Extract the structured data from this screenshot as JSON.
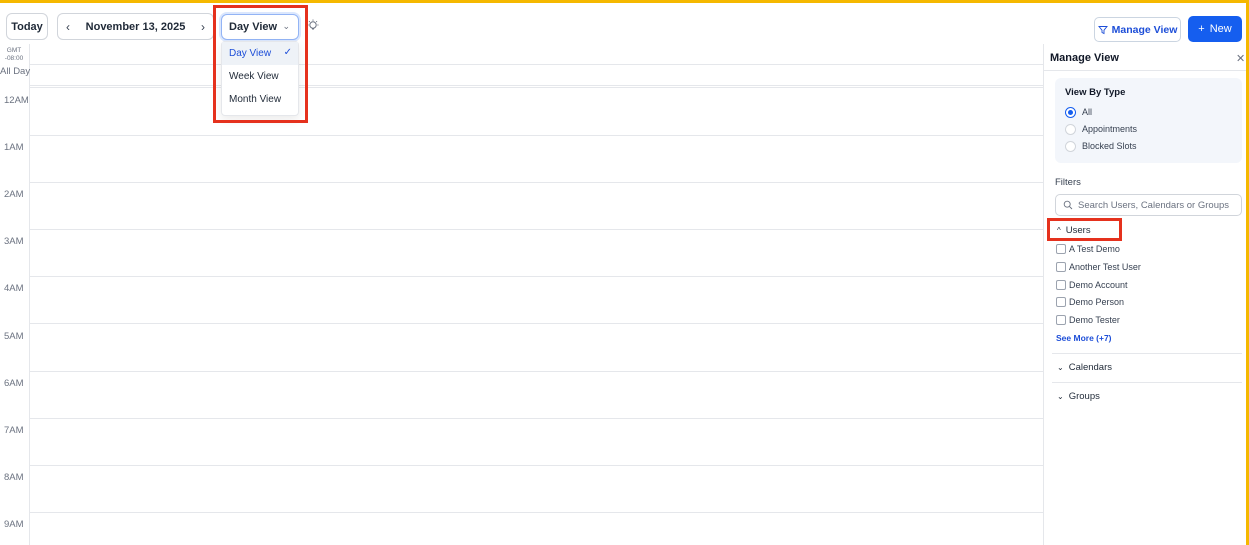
{
  "toolbar": {
    "today_label": "Today",
    "prev_icon": "chevron-left-icon",
    "next_icon": "chevron-right-icon",
    "date_label": "November 13, 2025",
    "view_selected": "Day View",
    "manage_view_label": "Manage View",
    "new_label": "New"
  },
  "view_dropdown": {
    "options": [
      {
        "label": "Day View",
        "selected": true
      },
      {
        "label": "Week View",
        "selected": false
      },
      {
        "label": "Month View",
        "selected": false
      }
    ]
  },
  "calendar": {
    "timezone": "GMT -08:00",
    "timezone_line1": "GMT",
    "timezone_line2": "-08:00",
    "all_day_label": "All Day",
    "hours": [
      "12AM",
      "1AM",
      "2AM",
      "3AM",
      "4AM",
      "5AM",
      "6AM",
      "7AM",
      "8AM",
      "9AM"
    ]
  },
  "manage_panel": {
    "title": "Manage View",
    "close_icon": "close-icon",
    "view_by_type": {
      "title": "View By Type",
      "options": [
        {
          "label": "All",
          "selected": true
        },
        {
          "label": "Appointments",
          "selected": false
        },
        {
          "label": "Blocked Slots",
          "selected": false
        }
      ]
    },
    "filters_title": "Filters",
    "search_placeholder": "Search Users, Calendars or Groups",
    "users": {
      "label": "Users",
      "expanded": true,
      "items": [
        "A Test Demo",
        "Another Test User",
        "Demo Account",
        "Demo Person",
        "Demo Tester"
      ],
      "see_more": "See More (+7)"
    },
    "calendars_label": "Calendars",
    "groups_label": "Groups"
  },
  "colors": {
    "accent": "#155eef",
    "highlight": "#e5311d",
    "frame": "#f5b800"
  }
}
